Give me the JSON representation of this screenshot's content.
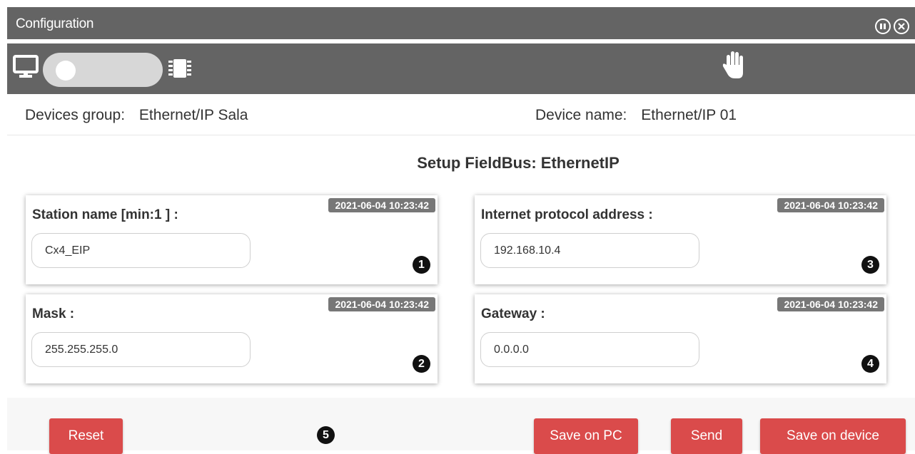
{
  "window": {
    "title": "Configuration"
  },
  "title_icons": [
    "pause-circle-icon",
    "close-circle-icon"
  ],
  "toolbar": {
    "icons": [
      "monitor-icon",
      "chip-icon",
      "hand-icon"
    ],
    "toggle_state": "off"
  },
  "info": {
    "group_label": "Devices group:",
    "group_value": "Ethernet/IP Sala",
    "device_label": "Device name:",
    "device_value": "Ethernet/IP 01"
  },
  "section_title": "Setup FieldBus: EthernetIP",
  "fields": {
    "station": {
      "label": "Station name [min:1 ] :",
      "timestamp": "2021-06-04 10:23:42",
      "value": "Cx4_EIP",
      "badge": "1"
    },
    "ip": {
      "label": "Internet protocol address :",
      "timestamp": "2021-06-04 10:23:42",
      "value": "192.168.10.4",
      "badge": "3"
    },
    "mask": {
      "label": "Mask :",
      "timestamp": "2021-06-04 10:23:42",
      "value": "255.255.255.0",
      "badge": "2"
    },
    "gateway": {
      "label": "Gateway :",
      "timestamp": "2021-06-04 10:23:42",
      "value": "0.0.0.0",
      "badge": "4"
    }
  },
  "footer": {
    "reset_label": "Reset",
    "badge": "5",
    "save_pc_label": "Save on PC",
    "send_label": "Send",
    "save_device_label": "Save on device"
  },
  "colors": {
    "titlebar": "#646464",
    "button": "#da4b4b",
    "stamp": "#777777"
  }
}
